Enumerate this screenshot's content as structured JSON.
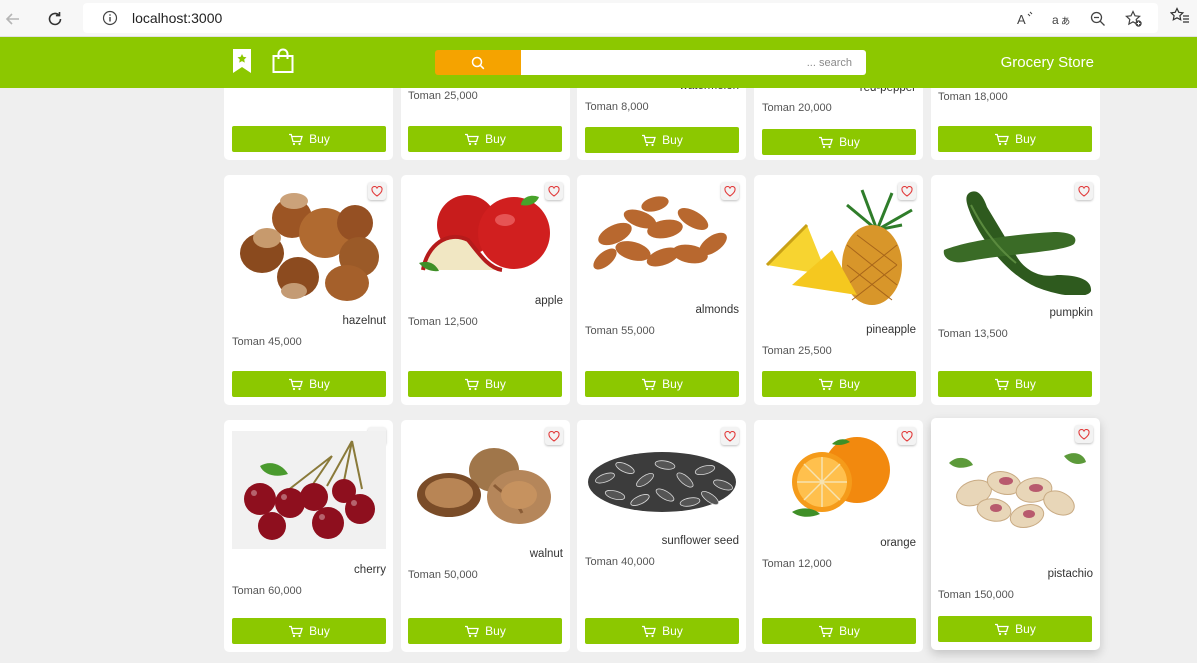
{
  "browser": {
    "url": "localhost:3000"
  },
  "header": {
    "title": "Grocery Store",
    "search_placeholder": "... search",
    "colors": {
      "brand": "#8cc800",
      "search_button": "#f5a300"
    },
    "icons": [
      "bookmark-icon",
      "shopping-bag-icon",
      "search-icon"
    ]
  },
  "product_rows": [
    {
      "products": [
        {
          "name": "",
          "price": ""
        },
        {
          "name": "",
          "price": "Toman 25,000"
        },
        {
          "name": "watermelon",
          "price": "Toman 8,000"
        },
        {
          "name": "red-pepper",
          "price": "Toman 20,000"
        },
        {
          "name": "",
          "price": "Toman 18,000"
        }
      ]
    },
    {
      "products": [
        {
          "name": "hazelnut",
          "price": "Toman 45,000"
        },
        {
          "name": "apple",
          "price": "Toman 12,500"
        },
        {
          "name": "almonds",
          "price": "Toman 55,000"
        },
        {
          "name": "pineapple",
          "price": "Toman 25,500"
        },
        {
          "name": "pumpkin",
          "price": "Toman 13,500"
        }
      ]
    },
    {
      "products": [
        {
          "name": "cherry",
          "price": "Toman 60,000"
        },
        {
          "name": "walnut",
          "price": "Toman 50,000"
        },
        {
          "name": "sunflower seed",
          "price": "Toman 40,000"
        },
        {
          "name": "orange",
          "price": "Toman 12,000"
        },
        {
          "name": "pistachio",
          "price": "Toman 150,000"
        }
      ]
    }
  ],
  "buy_label": "Buy"
}
